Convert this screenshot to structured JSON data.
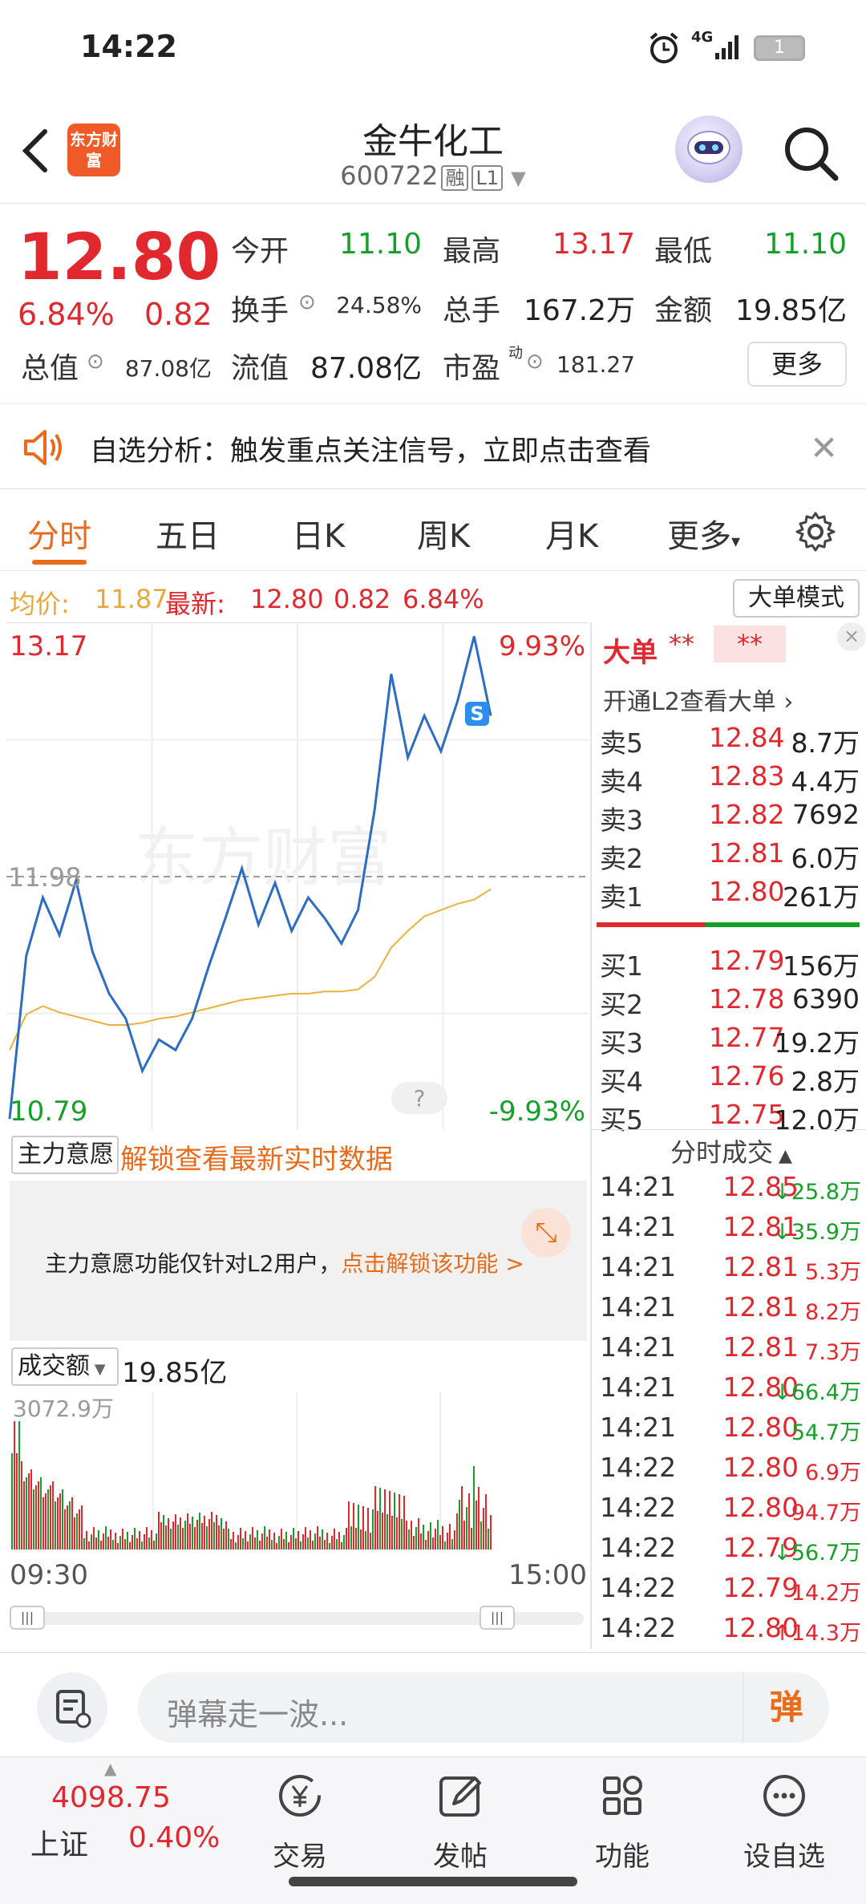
{
  "status": {
    "time": "14:22",
    "network": "4G",
    "battery": "1"
  },
  "header": {
    "title": "金牛化工",
    "code": "600722",
    "tag_margin": "融",
    "tag_level": "L1",
    "brand": "东方财富"
  },
  "quote": {
    "price": "12.80",
    "pct": "6.84%",
    "change": "0.82",
    "open_label": "今开",
    "open": "11.10",
    "high_label": "最高",
    "high": "13.17",
    "low_label": "最低",
    "low": "11.10",
    "turnover_label": "换手",
    "turnover": "24.58%",
    "volume_label": "总手",
    "volume": "167.2万",
    "amount_label": "金额",
    "amount": "19.85亿",
    "mktcap_label": "总值",
    "mktcap": "87.08亿",
    "float_label": "流值",
    "float": "87.08亿",
    "pe_label": "市盈",
    "pe_sup": "动",
    "pe": "181.27",
    "more": "更多"
  },
  "notice": {
    "text": "自选分析：触发重点关注信号，立即点击查看"
  },
  "tabs": [
    "分时",
    "五日",
    "日K",
    "周K",
    "月K",
    "更多"
  ],
  "info": {
    "avg_label": "均价:",
    "avg": "11.87",
    "latest_label": "最新:",
    "latest": "12.80",
    "chg": "0.82",
    "pct": "6.84%",
    "bigorder_btn": "大单模式"
  },
  "chart": {
    "high_label": "13.17",
    "high_pct": "9.93%",
    "prev_close": "11.98",
    "low_label": "10.79",
    "low_pct": "-9.93%",
    "watermark": "东方财富",
    "help": "?",
    "signal": "S",
    "colors": {
      "price": "#2b6cc4",
      "avg": "#e8b23c",
      "up": "#e0282e",
      "down": "#16a02a"
    }
  },
  "chart_data": {
    "type": "line",
    "title": "",
    "x_range": [
      "09:30",
      "15:00"
    ],
    "ylim": [
      10.79,
      13.17
    ],
    "prev_close": 11.98,
    "series": [
      {
        "values": [
          10.82,
          11.6,
          11.88,
          11.7,
          11.96,
          11.62,
          11.42,
          11.3,
          11.05,
          11.2,
          11.15,
          11.3,
          11.55,
          11.78,
          12.02,
          11.75,
          11.95,
          11.72,
          11.88,
          11.78,
          11.66,
          11.82,
          12.3,
          12.95,
          12.55,
          12.75,
          12.58,
          12.82,
          13.13,
          12.75
        ]
      },
      {
        "values": [
          11.15,
          11.32,
          11.36,
          11.33,
          11.31,
          11.29,
          11.27,
          11.27,
          11.28,
          11.3,
          11.31,
          11.33,
          11.35,
          11.37,
          11.39,
          11.4,
          11.41,
          11.42,
          11.42,
          11.43,
          11.43,
          11.44,
          11.5,
          11.64,
          11.72,
          11.79,
          11.82,
          11.85,
          11.87,
          11.92
        ]
      }
    ]
  },
  "orderbook": {
    "title": "大单",
    "stars1": "**",
    "stars2": "**",
    "close": "×",
    "l2_prompt": "开通L2查看大单 ›",
    "sells": [
      {
        "label": "卖5",
        "price": "12.84",
        "vol": "8.7万"
      },
      {
        "label": "卖4",
        "price": "12.83",
        "vol": "4.4万"
      },
      {
        "label": "卖3",
        "price": "12.82",
        "vol": "7692"
      },
      {
        "label": "卖2",
        "price": "12.81",
        "vol": "6.0万"
      },
      {
        "label": "卖1",
        "price": "12.80",
        "vol": "261万"
      }
    ],
    "buys": [
      {
        "label": "买1",
        "price": "12.79",
        "vol": "156万"
      },
      {
        "label": "买2",
        "price": "12.78",
        "vol": "6390"
      },
      {
        "label": "买3",
        "price": "12.77",
        "vol": "19.2万"
      },
      {
        "label": "买4",
        "price": "12.76",
        "vol": "2.8万"
      },
      {
        "label": "买5",
        "price": "12.75",
        "vol": "12.0万"
      }
    ],
    "ticks_title": "分时成交",
    "ticks": [
      {
        "time": "14:21",
        "price": "12.85",
        "vol": "↓25.8万",
        "dir": "down"
      },
      {
        "time": "14:21",
        "price": "12.81",
        "vol": "↓35.9万",
        "dir": "down"
      },
      {
        "time": "14:21",
        "price": "12.81",
        "vol": "5.3万",
        "dir": "up"
      },
      {
        "time": "14:21",
        "price": "12.81",
        "vol": "8.2万",
        "dir": "up"
      },
      {
        "time": "14:21",
        "price": "12.81",
        "vol": "7.3万",
        "dir": "up"
      },
      {
        "time": "14:21",
        "price": "12.80",
        "vol": "↓66.4万",
        "dir": "down"
      },
      {
        "time": "14:21",
        "price": "12.80",
        "vol": "54.7万",
        "dir": "down"
      },
      {
        "time": "14:22",
        "price": "12.80",
        "vol": "6.9万",
        "dir": "up"
      },
      {
        "time": "14:22",
        "price": "12.80",
        "vol": "94.7万",
        "dir": "up"
      },
      {
        "time": "14:22",
        "price": "12.79",
        "vol": "↓56.7万",
        "dir": "down"
      },
      {
        "time": "14:22",
        "price": "12.79",
        "vol": "14.2万",
        "dir": "up"
      },
      {
        "time": "14:22",
        "price": "12.80",
        "vol": "↑14.3万",
        "dir": "up"
      }
    ]
  },
  "mainforce": {
    "select": "主力意愿",
    "unlock": "解锁查看最新实时数据",
    "info": "主力意愿功能仅针对L2用户，",
    "info_link": "点击解锁该功能 >"
  },
  "volume": {
    "select": "成交额",
    "amount": "19.85亿",
    "max_label": "3072.9万",
    "time_start": "09:30",
    "time_end": "15:00"
  },
  "danmaku": {
    "placeholder": "弹幕走一波...",
    "send": "弹"
  },
  "bottom": {
    "index_value": "4098.75",
    "index_name": "上证",
    "index_pct": "0.40%",
    "items": [
      {
        "label": "交易",
        "icon": "yen-circle-icon"
      },
      {
        "label": "发帖",
        "icon": "edit-icon"
      },
      {
        "label": "功能",
        "icon": "grid-icon"
      },
      {
        "label": "设自选",
        "icon": "dots-circle-icon"
      }
    ]
  }
}
